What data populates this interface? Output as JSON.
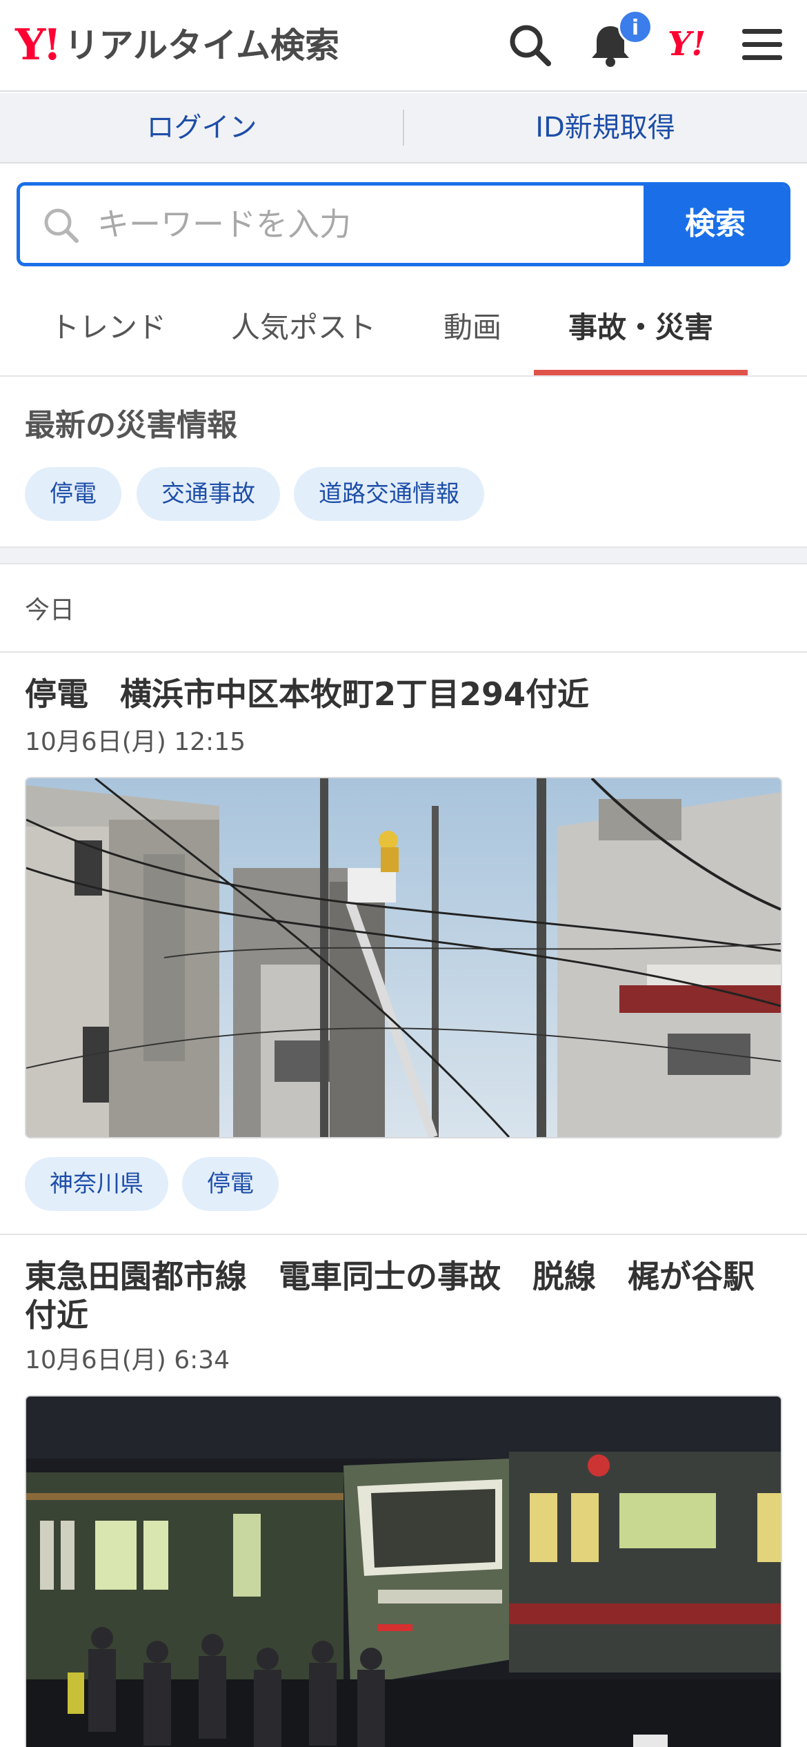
{
  "header": {
    "logo_mark": "Y!",
    "logo_text": "リアルタイム検索",
    "notification_badge": "i",
    "ybadge": "Y!",
    "icons": [
      "search-icon",
      "bell-icon",
      "menu-icon"
    ]
  },
  "account": {
    "login": "ログイン",
    "signup": "ID新規取得"
  },
  "search": {
    "placeholder": "キーワードを入力",
    "button": "検索"
  },
  "tabs": [
    {
      "label": "トレンド"
    },
    {
      "label": "人気ポスト"
    },
    {
      "label": "動画"
    },
    {
      "label": "事故・災害",
      "active": true
    }
  ],
  "disaster": {
    "title": "最新の災害情報",
    "chips": [
      "停電",
      "交通事故",
      "道路交通情報"
    ]
  },
  "feed": {
    "section_label": "今日",
    "articles": [
      {
        "title": "停電　横浜市中区本牧町2丁目294付近",
        "date": "10月6日(月) 12:15",
        "tags": [
          "神奈川県",
          "停電"
        ]
      },
      {
        "title": "東急田園都市線　電車同士の事故　脱線　梶が谷駅付近",
        "date": "10月6日(月) 6:34"
      }
    ]
  },
  "colors": {
    "brand_red": "#ff0033",
    "accent_blue": "#1a6fe8",
    "link_blue": "#1d4ea8",
    "tab_underline": "#e0534a",
    "chip_bg": "#e3eefb"
  }
}
